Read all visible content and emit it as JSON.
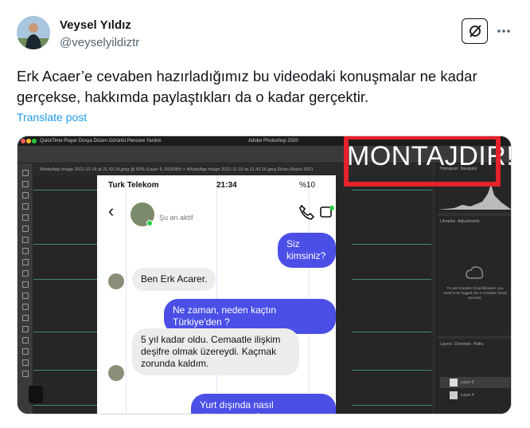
{
  "author": {
    "name": "Veysel Yıldız",
    "handle": "@veyselyildiztr"
  },
  "post": {
    "text": "Erk Acaer’e cevaben hazırladığımız bu videodaki konuşmalar ne kadar gerçekse, hakkımda paylaştıkları da o kadar gerçektir.",
    "translate_label": "Translate post"
  },
  "media": {
    "os_menu": "QuickTime Player   Dosya   Düzen   Görüntü   Pencere   Yardım",
    "app_title": "Adobe Photoshop 2020",
    "doc_tabs": "WhatsApp Image 2021-11-19 at 21.43.14.jpeg @ 82% (Layer 5, RGB/8#) ×    WhatsApp Image 2021-11-19 at 21.43.16.jpeg    Ekran Resmi 2021",
    "overlay_caption": "MONTAJDIR!",
    "panel_tabs": [
      "Histogram",
      "Navigator"
    ],
    "panel_tabs2": [
      "Libraries",
      "Adjustments"
    ],
    "panel_message": "To use Creative Cloud libraries, you need to be logged into a Creative Cloud account.",
    "layers_tabs": [
      "Layers",
      "Channels",
      "Paths"
    ],
    "layer_names": [
      "Layer 5",
      "Layer 4"
    ],
    "phone": {
      "carrier": "Turk Telekom",
      "time": "21:34",
      "battery": "%10",
      "contact_status": "Şu an aktif",
      "messages": [
        {
          "dir": "out",
          "text": "Siz kimsiniz?"
        },
        {
          "dir": "in",
          "text": "Ben Erk Acarer."
        },
        {
          "dir": "out",
          "text": "Ne zaman, neden kaçtın Türkiye'den ?"
        },
        {
          "dir": "in",
          "text": "5 yıl kadar oldu. Cemaatle ilişkim deşifre olmak üzereydi. Kaçmak zorunda kaldım."
        },
        {
          "dir": "out",
          "text": "Yurt dışında nasıl gizleniyorsun?"
        }
      ]
    }
  },
  "colors": {
    "accent_link": "#1d9bf0",
    "bubble_out": "#4b4fe6",
    "highlight_box": "#e5222a"
  },
  "icons": [
    "grok-icon",
    "more-icon",
    "back-chevron-icon",
    "phone-call-icon",
    "video-call-icon"
  ]
}
